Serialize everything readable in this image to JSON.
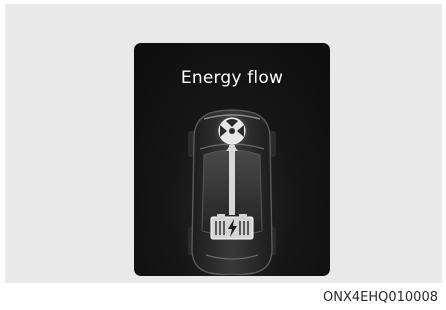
{
  "screen": {
    "title": "Energy flow",
    "icons": [
      "car-top-view-icon",
      "motor-icon",
      "battery-icon",
      "energy-flow-arrow-icon"
    ]
  },
  "caption": "ONX4EHQ010008",
  "colors": {
    "background": "#e9e9e9",
    "screen": "#151515",
    "text": "#ffffff",
    "accent": "#cfcfcf"
  }
}
